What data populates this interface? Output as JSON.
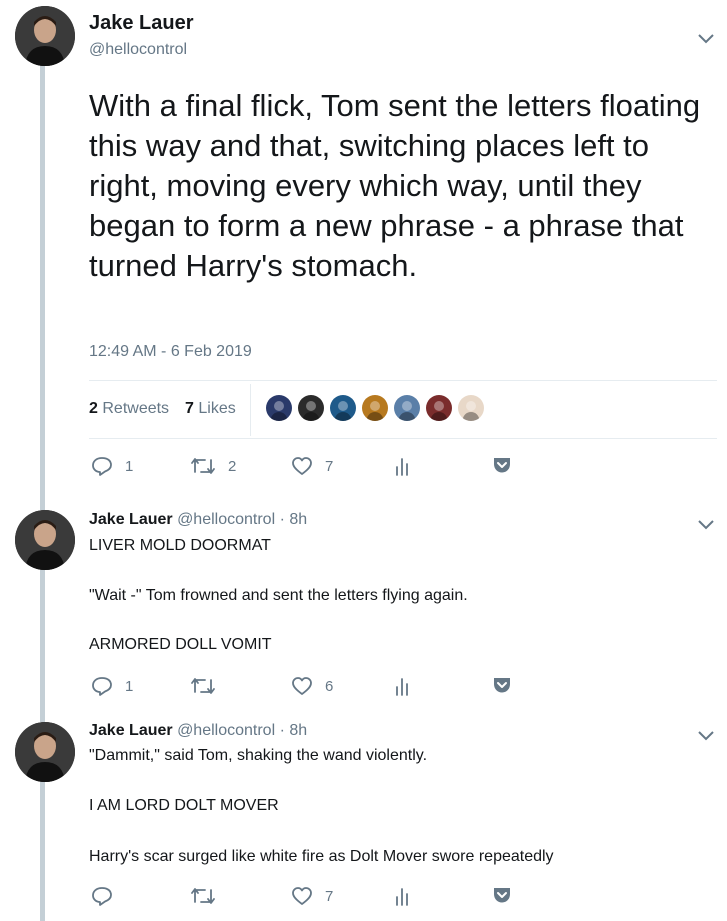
{
  "main_tweet": {
    "display_name": "Jake Lauer",
    "handle": "@hellocontrol",
    "text": "With a final flick, Tom sent the letters floating this way and that, switching places left to right, moving every which way, until they began to form a new phrase - a phrase that turned Harry's stomach.",
    "timestamp": "12:49 AM - 6 Feb 2019",
    "retweets_count": "2",
    "retweets_label": "Retweets",
    "likes_count": "7",
    "likes_label": "Likes",
    "liker_avatar_colors": [
      "#2a3a6a",
      "#2b2b2b",
      "#1e5a8a",
      "#b7791f",
      "#5a7fa8",
      "#7a2c2c",
      "#e8d8c8"
    ],
    "actions": {
      "reply": "1",
      "retweet": "2",
      "like": "7"
    }
  },
  "replies": [
    {
      "display_name": "Jake Lauer",
      "handle": "@hellocontrol",
      "time": "· 8h",
      "lines": [
        "LIVER MOLD DOORMAT",
        "\"Wait -\" Tom frowned and sent the letters flying again.",
        "ARMORED DOLL VOMIT"
      ],
      "actions": {
        "reply": "1",
        "retweet": "",
        "like": "6"
      }
    },
    {
      "display_name": "Jake Lauer",
      "handle": "@hellocontrol",
      "time": "· 8h",
      "lines": [
        "\"Dammit,\" said Tom, shaking the wand violently.",
        "I AM LORD DOLT MOVER",
        "Harry's scar surged like white fire as Dolt Mover swore repeatedly"
      ],
      "actions": {
        "reply": "",
        "retweet": "",
        "like": "7"
      }
    }
  ],
  "colors": {
    "thread_line": "#c4cfd6",
    "muted": "#657786",
    "text": "#14171a"
  }
}
